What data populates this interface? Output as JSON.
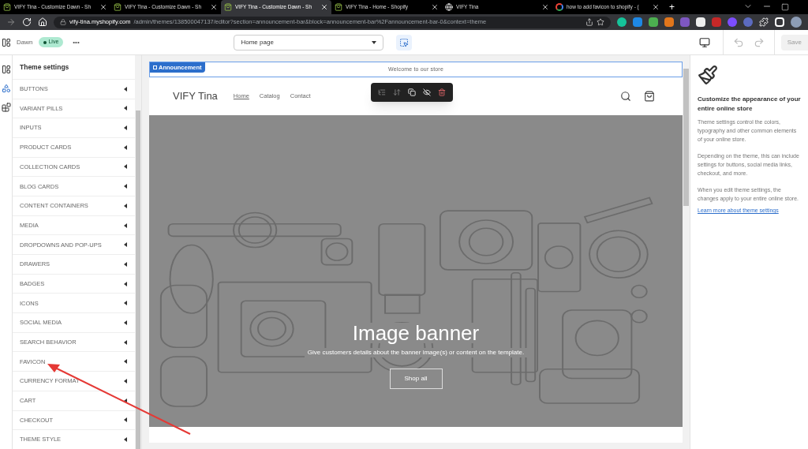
{
  "browser": {
    "tabs": [
      {
        "title": "VIFY Tina - Customize Dawn - Sh",
        "kind": "shopify",
        "selected": false
      },
      {
        "title": "VIFY Tina - Customize Dawn - Sh",
        "kind": "shopify",
        "selected": false
      },
      {
        "title": "VIFY Tina - Customize Dawn - Sh",
        "kind": "shopify",
        "selected": true
      },
      {
        "title": "VIFY Tina - Home - Shopify",
        "kind": "shopify",
        "selected": false
      },
      {
        "title": "VIFY Tina",
        "kind": "globe",
        "selected": false
      },
      {
        "title": "how to add favicon to shopify - (",
        "kind": "google",
        "selected": false
      }
    ],
    "new_tab": "+",
    "address": {
      "host": "vify-tina.myshopify.com",
      "path": "/admin/themes/138500047137/editor?section=announcement-bar&block=announcement-bar%2Fannouncement-bar-0&context=theme"
    }
  },
  "editor_bar": {
    "theme_name": "Dawn",
    "status": "Live",
    "more": "•••",
    "template": "Home page",
    "save": {
      "label": "Save",
      "disabled": true
    }
  },
  "rail": [
    {
      "kind": "sections",
      "selected": false
    },
    {
      "kind": "settings",
      "selected": true
    },
    {
      "kind": "apps",
      "selected": false
    }
  ],
  "sidebar": {
    "title": "Theme settings",
    "items": [
      {
        "label": "BUTTONS"
      },
      {
        "label": "VARIANT PILLS"
      },
      {
        "label": "INPUTS"
      },
      {
        "label": "PRODUCT CARDS"
      },
      {
        "label": "COLLECTION CARDS"
      },
      {
        "label": "BLOG CARDS"
      },
      {
        "label": "CONTENT CONTAINERS"
      },
      {
        "label": "MEDIA"
      },
      {
        "label": "DROPDOWNS AND POP-UPS"
      },
      {
        "label": "DRAWERS"
      },
      {
        "label": "BADGES"
      },
      {
        "label": "ICONS"
      },
      {
        "label": "SOCIAL MEDIA"
      },
      {
        "label": "SEARCH BEHAVIOR"
      },
      {
        "label": "FAVICON"
      },
      {
        "label": "CURRENCY FORMAT"
      },
      {
        "label": "CART"
      },
      {
        "label": "CHECKOUT"
      },
      {
        "label": "THEME STYLE"
      }
    ]
  },
  "preview": {
    "announcement": {
      "tag": "Announcement",
      "text": "Welcome to our store"
    },
    "header": {
      "logo": "VIFY Tina",
      "nav": [
        {
          "label": "Home",
          "selected": true
        },
        {
          "label": "Catalog",
          "selected": false
        },
        {
          "label": "Contact",
          "selected": false
        }
      ]
    },
    "banner": {
      "heading": "Image banner",
      "text": "Give customers details about the banner image(s) or content on the template.",
      "button": "Shop all"
    }
  },
  "info_panel": {
    "title": "Customize the appearance of your entire online store",
    "paragraphs": [
      "Theme settings control the colors, typography and other common elements of your online store.",
      "Depending on the theme, this can include settings for buttons, social media links, checkout, and more.",
      "When you edit theme settings, the changes apply to your entire online store."
    ],
    "link": "Learn more about theme settings"
  }
}
